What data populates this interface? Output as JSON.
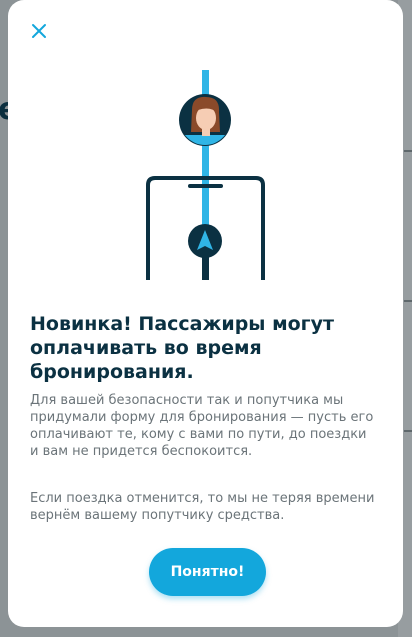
{
  "modal": {
    "title": "Новинка! Пассажиры могут оплачивать во время бронирования.",
    "paragraph1": "Для вашей безопасности так и попутчика мы придумали форму для бронирования — пусть его оплачивают те, кому с вами по пути, до поездки и вам не придется беспокоится.",
    "paragraph2": "Если поездка отменится, то мы не теряя времени вернём вашему попутчику средства.",
    "ok_label": "Понятно!"
  },
  "icons": {
    "close": "close-icon",
    "avatar": "passenger-avatar-icon",
    "navigation": "navigation-arrow-icon"
  },
  "colors": {
    "accent": "#13a7dc",
    "title": "#0b3142",
    "text": "#6b7479",
    "line_light": "#30b5e6"
  }
}
